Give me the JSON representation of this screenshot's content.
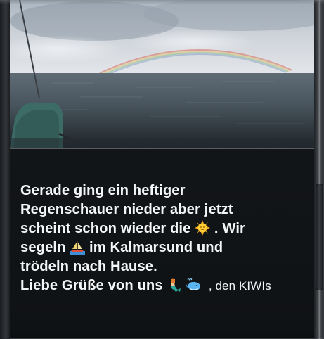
{
  "message": {
    "line1": "Gerade ging ein heftiger",
    "line2": "Regenschauer nieder aber jetzt",
    "line3_a": "scheint schon wieder die",
    "line3_b": ". Wir",
    "line4_a": "segeln",
    "line4_b": "im Kalmarsund und",
    "line5": "trödeln nach Hause.",
    "line6_a": "Liebe Grüße von uns",
    "signature": ", den KIWIs"
  },
  "icons": {
    "sun": "sun-emoji",
    "sailboat": "sailboat-emoji",
    "mermaid": "mermaid-emoji",
    "whale": "whale-emoji"
  },
  "colors": {
    "background": "#0f1214",
    "text": "#f4f5f6",
    "sea": "#4c5a63",
    "sky": "#c7ccd1"
  }
}
